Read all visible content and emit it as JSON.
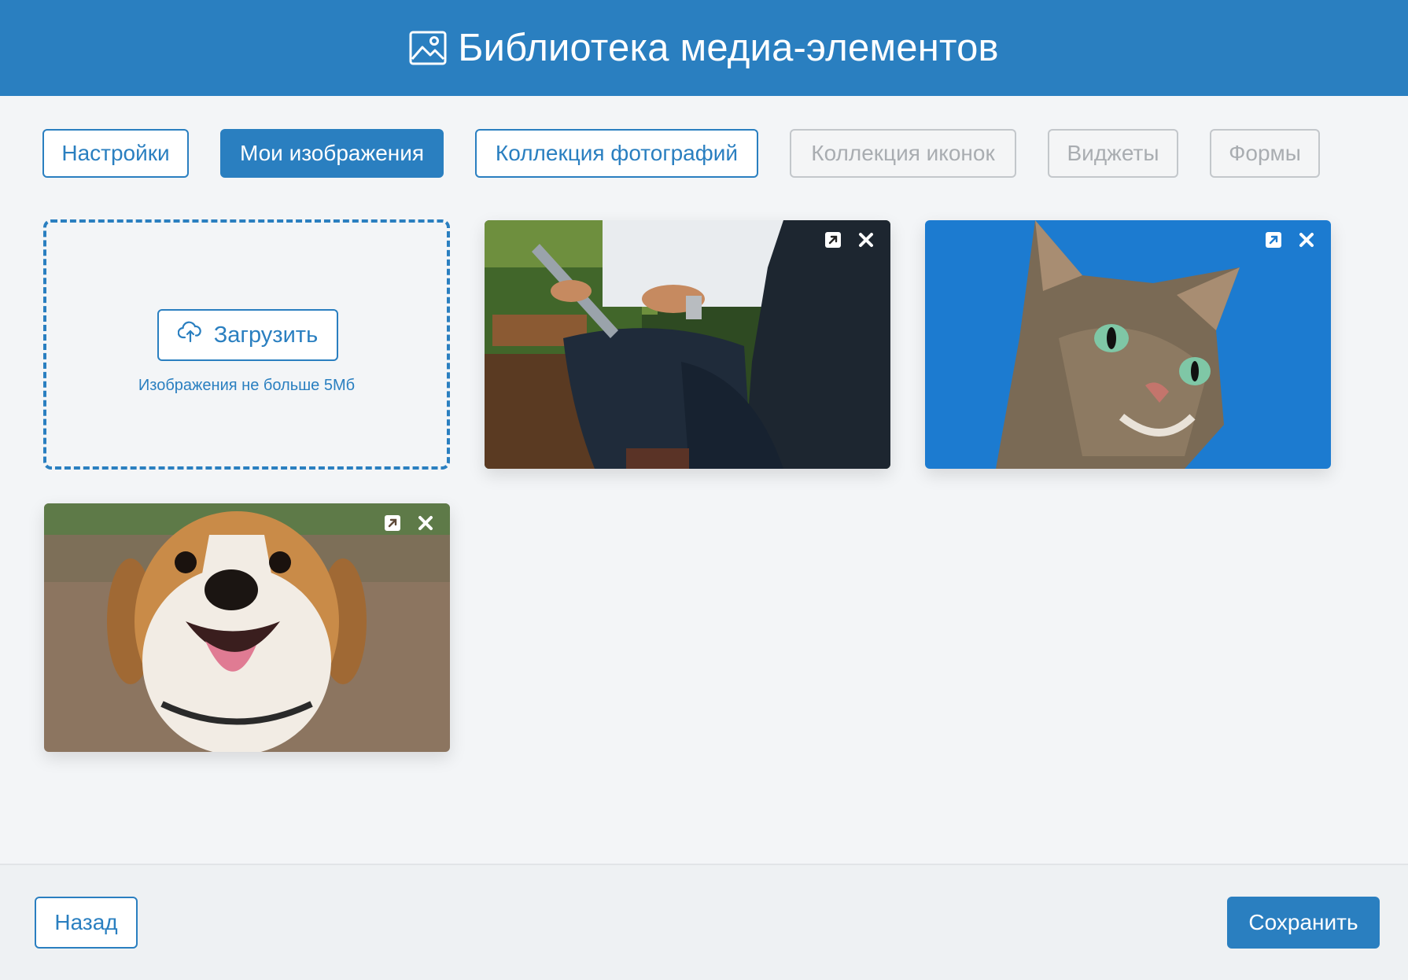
{
  "header": {
    "title": "Библиотека медиа-элементов",
    "icon": "image-icon"
  },
  "tabs": [
    {
      "label": "Настройки",
      "state": "normal"
    },
    {
      "label": "Мои изображения",
      "state": "active"
    },
    {
      "label": "Коллекция фотографий",
      "state": "normal"
    },
    {
      "label": "Коллекция иконок",
      "state": "disabled"
    },
    {
      "label": "Виджеты",
      "state": "disabled"
    },
    {
      "label": "Формы",
      "state": "disabled"
    }
  ],
  "upload": {
    "button_label": "Загрузить",
    "hint": "Изображения не больше 5Мб",
    "icon": "cloud-upload-icon"
  },
  "images": [
    {
      "subject": "business-man-tablet",
      "actions": [
        "expand-icon",
        "close-icon"
      ]
    },
    {
      "subject": "cat",
      "actions": [
        "expand-icon",
        "close-icon"
      ]
    },
    {
      "subject": "beagle-dog",
      "actions": [
        "expand-icon",
        "close-icon"
      ]
    }
  ],
  "footer": {
    "back_label": "Назад",
    "save_label": "Сохранить"
  },
  "colors": {
    "accent": "#2a7fc0",
    "background": "#f3f5f7",
    "disabled": "#a9adb1"
  }
}
